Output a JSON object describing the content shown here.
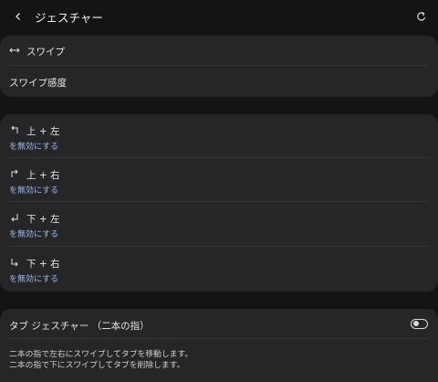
{
  "header": {
    "title": "ジェスチャー"
  },
  "card1": {
    "swipe_label": "スワイプ",
    "sensitivity_label": "スワイプ感度"
  },
  "card2": {
    "items": [
      {
        "label": "上 + 左",
        "sub": "を無効にする",
        "icon": "arrow-up-left-icon"
      },
      {
        "label": "上 + 右",
        "sub": "を無効にする",
        "icon": "arrow-up-right-icon"
      },
      {
        "label": "下 + 左",
        "sub": "を無効にする",
        "icon": "arrow-down-left-icon"
      },
      {
        "label": "下 + 右",
        "sub": "を無効にする",
        "icon": "arrow-down-right-icon"
      }
    ]
  },
  "card3": {
    "label": "タブ ジェスチャー （二本の指）",
    "toggle_on": false,
    "desc_line1": "二本の指で左右にスワイプしてタブを移動します。",
    "desc_line2": "二本の指で下にスワイプしてタブを削除します。"
  },
  "colors": {
    "background": "#141414",
    "card": "#262628",
    "accent_sub": "#9fb8e8"
  }
}
